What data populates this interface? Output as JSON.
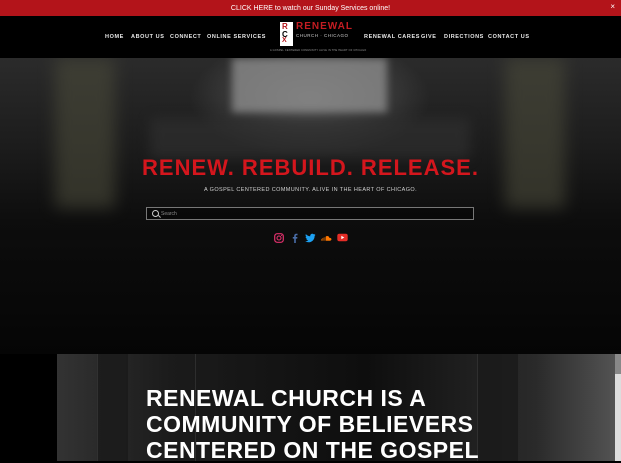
{
  "announcement": {
    "text": "CLICK HERE to watch our Sunday Services online!",
    "close": "×"
  },
  "nav": {
    "left": [
      "HOME",
      "ABOUT US",
      "CONNECT",
      "ONLINE SERVICES"
    ],
    "right": [
      "RENEWAL CARES",
      "GIVE",
      "DIRECTIONS",
      "CONTACT US"
    ]
  },
  "logo": {
    "mark_letters": [
      "R",
      "C",
      "X"
    ],
    "title": "RENEWAL",
    "subtitle": "CHURCH · CHICAGO",
    "tagline": "A GOSPEL CENTERED COMMUNITY ALIVE IN THE HEART OF CHICAGO"
  },
  "hero": {
    "headline": "RENEW. REBUILD. RELEASE.",
    "subline": "A GOSPEL CENTERED COMMUNITY. ALIVE IN THE HEART OF CHICAGO.",
    "search_placeholder": "Search"
  },
  "socials": [
    {
      "name": "instagram-icon",
      "color": "#e1306c"
    },
    {
      "name": "facebook-icon",
      "color": "#3b5998"
    },
    {
      "name": "twitter-icon",
      "color": "#1da1f2"
    },
    {
      "name": "soundcloud-icon",
      "color": "#ff7700"
    },
    {
      "name": "youtube-icon",
      "color": "#e52d27"
    }
  ],
  "about": {
    "lines": [
      "RENEWAL CHURCH IS A",
      "COMMUNITY OF BELIEVERS",
      "CENTERED ON THE GOSPEL"
    ]
  },
  "colors": {
    "brand_red": "#c41c22",
    "bar_red": "#b3141a"
  }
}
